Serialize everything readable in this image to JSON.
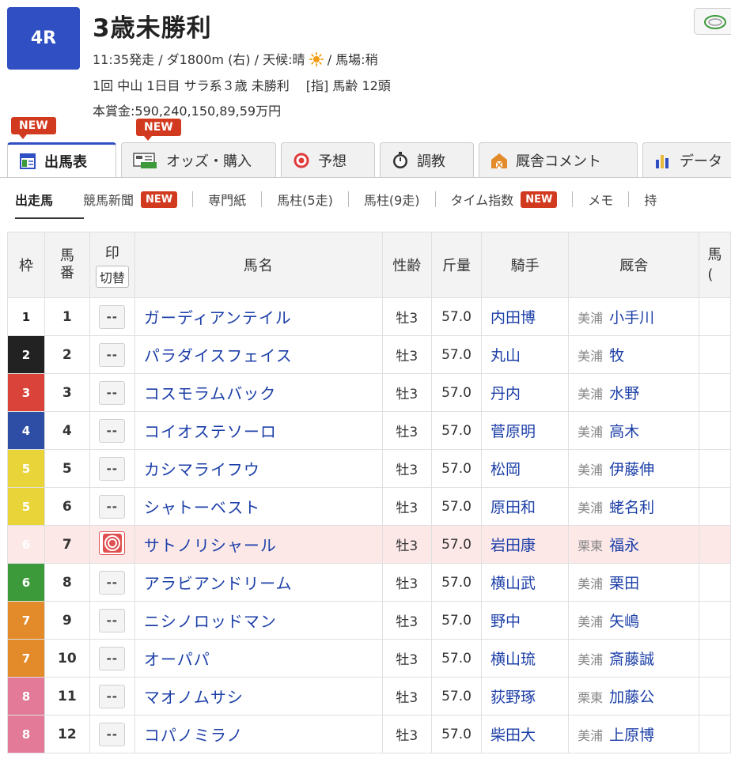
{
  "race": {
    "number": "4R",
    "title": "3歳未勝利",
    "line1_pre": "11:35発走 / ダ1800m (右) / 天候:晴",
    "line1_post": "/ 馬場:稍",
    "line2": "1回 中山 1日目 サラ系３歳 未勝利　 [指] 馬齢 12頭",
    "line3": "本賞金:590,240,150,89,59万円"
  },
  "tabs": {
    "new_label": "NEW",
    "items": [
      {
        "label": "出馬表",
        "icon": "table-icon"
      },
      {
        "label": "オッズ・購入",
        "icon": "ipat-icon"
      },
      {
        "label": "予想",
        "icon": "target-icon"
      },
      {
        "label": "調教",
        "icon": "stopwatch-icon"
      },
      {
        "label": "厩舎コメント",
        "icon": "barn-icon"
      },
      {
        "label": "データ",
        "icon": "bar-chart-icon"
      }
    ]
  },
  "subtabs": {
    "items": [
      "出走馬",
      "競馬新聞",
      "専門紙",
      "馬柱(5走)",
      "馬柱(9走)",
      "タイム指数",
      "メモ",
      "持"
    ],
    "new_label": "NEW"
  },
  "table": {
    "headers": {
      "waku": "枠",
      "umaban": "馬番",
      "mark": "印",
      "mark_toggle": "切替",
      "name": "馬名",
      "age": "性齢",
      "kin": "斤量",
      "jockey": "騎手",
      "stable": "厩舎",
      "last": "馬(",
      "last_a": "馬",
      "last_b": "("
    },
    "rows": [
      {
        "waku": "1",
        "umaban": "1",
        "mark": "--",
        "name": "ガーディアンテイル",
        "age": "牡3",
        "kin": "57.0",
        "jockey": "内田博",
        "loc": "美浦",
        "trainer": "小手川"
      },
      {
        "waku": "2",
        "umaban": "2",
        "mark": "--",
        "name": "パラダイスフェイス",
        "age": "牡3",
        "kin": "57.0",
        "jockey": "丸山",
        "loc": "美浦",
        "trainer": "牧"
      },
      {
        "waku": "3",
        "umaban": "3",
        "mark": "--",
        "name": "コスモラムバック",
        "age": "牡3",
        "kin": "57.0",
        "jockey": "丹内",
        "loc": "美浦",
        "trainer": "水野"
      },
      {
        "waku": "4",
        "umaban": "4",
        "mark": "--",
        "name": "コイオステソーロ",
        "age": "牡3",
        "kin": "57.0",
        "jockey": "菅原明",
        "loc": "美浦",
        "trainer": "高木"
      },
      {
        "waku": "5",
        "umaban": "5",
        "mark": "--",
        "name": "カシマライフウ",
        "age": "牡3",
        "kin": "57.0",
        "jockey": "松岡",
        "loc": "美浦",
        "trainer": "伊藤伸"
      },
      {
        "waku": "5",
        "umaban": "6",
        "mark": "--",
        "name": "シャトーベスト",
        "age": "牡3",
        "kin": "57.0",
        "jockey": "原田和",
        "loc": "美浦",
        "trainer": "蛯名利"
      },
      {
        "waku": "6",
        "umaban": "7",
        "mark": "◎",
        "name": "サトノリシャール",
        "age": "牡3",
        "kin": "57.0",
        "jockey": "岩田康",
        "loc": "栗東",
        "trainer": "福永"
      },
      {
        "waku": "6",
        "umaban": "8",
        "mark": "--",
        "name": "アラビアンドリーム",
        "age": "牡3",
        "kin": "57.0",
        "jockey": "横山武",
        "loc": "美浦",
        "trainer": "栗田"
      },
      {
        "waku": "7",
        "umaban": "9",
        "mark": "--",
        "name": "ニシノロッドマン",
        "age": "牡3",
        "kin": "57.0",
        "jockey": "野中",
        "loc": "美浦",
        "trainer": "矢嶋"
      },
      {
        "waku": "7",
        "umaban": "10",
        "mark": "--",
        "name": "オーパパ",
        "age": "牡3",
        "kin": "57.0",
        "jockey": "横山琉",
        "loc": "美浦",
        "trainer": "斎藤誠"
      },
      {
        "waku": "8",
        "umaban": "11",
        "mark": "--",
        "name": "マオノムサシ",
        "age": "牡3",
        "kin": "57.0",
        "jockey": "荻野琢",
        "loc": "栗東",
        "trainer": "加藤公"
      },
      {
        "waku": "8",
        "umaban": "12",
        "mark": "--",
        "name": "コパノミラノ",
        "age": "牡3",
        "kin": "57.0",
        "jockey": "柴田大",
        "loc": "美浦",
        "trainer": "上原博"
      }
    ]
  },
  "colors": {
    "accent": "#2f4fc2",
    "new_badge": "#d23a1f",
    "link": "#1c3fa8",
    "highlight_row": "#fde8e8"
  }
}
